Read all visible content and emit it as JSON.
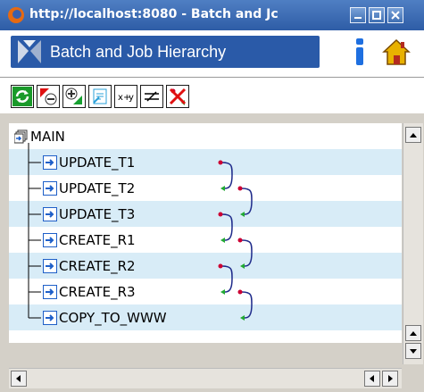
{
  "window": {
    "title": "http://localhost:8080 - Batch and Jc",
    "min_icon": "minimize-icon",
    "max_icon": "maximize-icon",
    "close_icon": "close-icon"
  },
  "app": {
    "title": "Batch and Job Hierarchy",
    "info_icon": "info-icon",
    "home_icon": "home-icon"
  },
  "toolbar": {
    "buttons": [
      "refresh-icon",
      "collapse-icon",
      "expand-icon",
      "document-icon",
      "xy-icon",
      "compare-icon",
      "remove-dependency-icon"
    ]
  },
  "tree": {
    "root": "MAIN",
    "items": [
      {
        "label": "UPDATE_T1"
      },
      {
        "label": "UPDATE_T2"
      },
      {
        "label": "UPDATE_T3"
      },
      {
        "label": "CREATE_R1"
      },
      {
        "label": "CREATE_R2"
      },
      {
        "label": "CREATE_R3"
      },
      {
        "label": "COPY_TO_WWW"
      }
    ]
  },
  "colors": {
    "titlebar": "#3a69b0",
    "header_panel": "#2a5aa8",
    "row_alt": "#d8ecf7",
    "dependency_start": "#cc0033",
    "dependency_end": "#22aa33"
  }
}
